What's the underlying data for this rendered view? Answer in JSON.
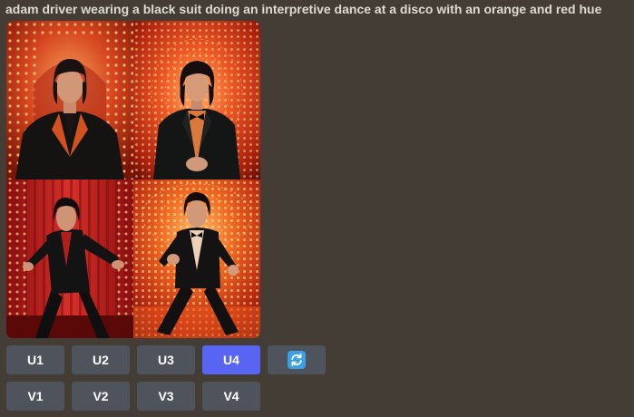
{
  "prompt": {
    "text": "adam driver wearing a black suit doing an interpretive dance at a disco with an orange and red hue"
  },
  "image_grid": {
    "cells": [
      {
        "icon": "image-variant-1"
      },
      {
        "icon": "image-variant-2"
      },
      {
        "icon": "image-variant-3"
      },
      {
        "icon": "image-variant-4"
      }
    ]
  },
  "upscale_buttons": [
    {
      "label": "U1",
      "active": false
    },
    {
      "label": "U2",
      "active": false
    },
    {
      "label": "U3",
      "active": false
    },
    {
      "label": "U4",
      "active": true
    }
  ],
  "reroll_button": {
    "icon": "refresh-icon",
    "color": "#3aa0e8"
  },
  "variation_buttons": [
    {
      "label": "V1"
    },
    {
      "label": "V2"
    },
    {
      "label": "V3"
    },
    {
      "label": "V4"
    }
  ],
  "colors": {
    "background": "#443d35",
    "button": "#4f545c",
    "button_active": "#5865f2"
  }
}
